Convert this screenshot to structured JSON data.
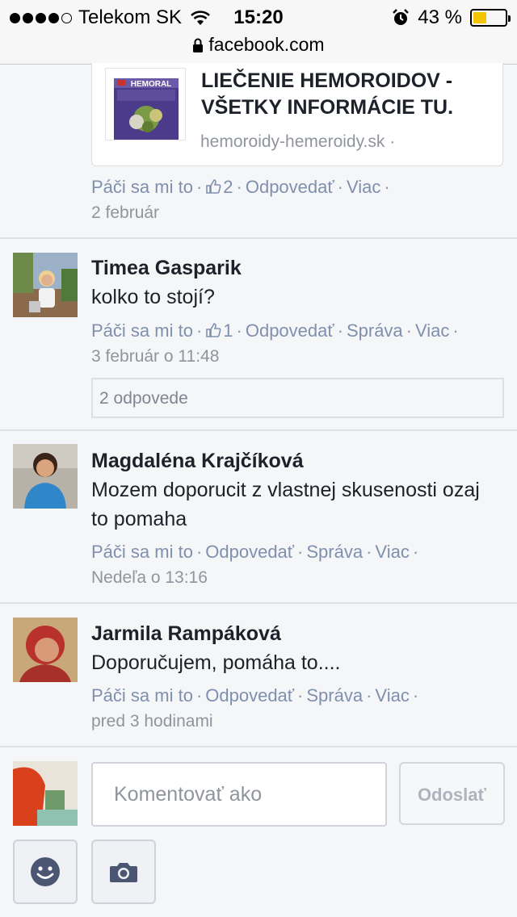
{
  "status_bar": {
    "carrier": "Telekom SK",
    "time": "15:20",
    "battery_text": "43 %",
    "battery_level": 0.43,
    "url": "facebook.com"
  },
  "link_preview": {
    "title": "LIEČENIE HEMOROIDOV - VŠETKY INFORMÁCIE TU.",
    "domain": "hemoroidy-hemeroidy.sk ·",
    "image_brand": "HEMORAL"
  },
  "top_comment": {
    "actions": {
      "like": "Páči sa mi to",
      "likes": "2",
      "reply": "Odpovedať",
      "more": "Viac"
    },
    "date": "2 február"
  },
  "comments": [
    {
      "name": "Timea Gasparik",
      "text": "kolko to stojí?",
      "actions": {
        "like": "Páči sa mi to",
        "likes": "1",
        "reply": "Odpovedať",
        "message": "Správa",
        "more": "Viac"
      },
      "date": "3 február o 11:48",
      "replies": "2 odpovede"
    },
    {
      "name": "Magdaléna Krajčíková",
      "text": "Mozem doporucit z vlastnej skusenosti ozaj to pomaha",
      "actions": {
        "like": "Páči sa mi to",
        "reply": "Odpovedať",
        "message": "Správa",
        "more": "Viac"
      },
      "date": "Nedeľa o 13:16"
    },
    {
      "name": "Jarmila Rampáková",
      "text": "Doporučujem, pomáha to....",
      "actions": {
        "like": "Páči sa mi to",
        "reply": "Odpovedať",
        "message": "Správa",
        "more": "Viac"
      },
      "date": "pred 3 hodinami"
    }
  ],
  "composer": {
    "placeholder": "Komentovať ako",
    "send_label": "Odoslať",
    "emoji_icon": "smiley-icon",
    "camera_icon": "camera-icon"
  },
  "colors": {
    "link": "#7f8fae",
    "meta_grey": "#90949c",
    "background": "#f5f6f8"
  }
}
